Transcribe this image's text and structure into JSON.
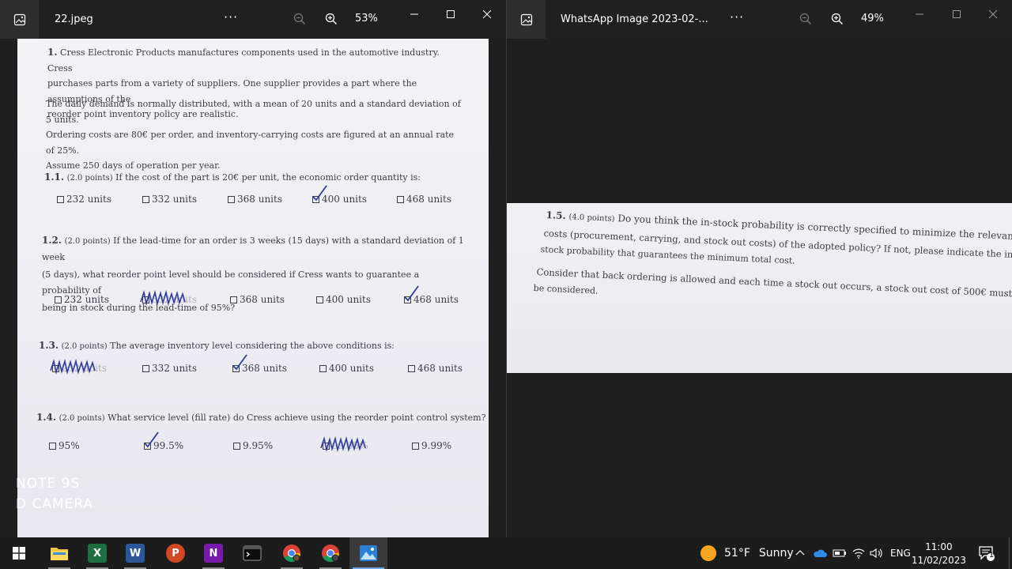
{
  "left_window": {
    "title": "22.jpeg",
    "more": "···",
    "zoom": "53%",
    "icons": [
      "photos-app-icon",
      "zoom-out-icon",
      "zoom-in-icon",
      "minimize-icon",
      "maximize-icon",
      "close-icon"
    ]
  },
  "right_window": {
    "title": "WhatsApp Image 2023-02-...",
    "more": "···",
    "zoom": "49%",
    "icons": [
      "photos-app-icon",
      "zoom-out-icon",
      "zoom-in-icon",
      "minimize-icon",
      "maximize-icon",
      "close-icon"
    ]
  },
  "document": {
    "intro_num": "1.",
    "intro_lines": [
      "Cress Electronic Products manufactures components used in the automotive industry. Cress",
      "purchases parts from a variety of suppliers. One supplier provides a part where the assumptions of the",
      "reorder point inventory policy are realistic."
    ],
    "details_lines": [
      "The daily demand is normally distributed, with a mean of 20 units and a standard deviation of 5 units.",
      "Ordering costs are 80€ per order, and inventory-carrying costs are figured at an annual rate of 25%.",
      "Assume 250 days of operation per year."
    ],
    "questions": [
      {
        "num": "1.1.",
        "points": "(2.0 points)",
        "text_lines": [
          "If the cost of the part is 20€ per unit, the economic order quantity is:"
        ],
        "options": [
          "232 units",
          "332 units",
          "368 units",
          "400 units",
          "468 units"
        ],
        "checked": 3,
        "scribbled": []
      },
      {
        "num": "1.2.",
        "points": "(2.0 points)",
        "text_lines": [
          "If the lead-time for an order is 3 weeks (15 days) with a standard deviation of 1 week",
          "(5 days), what reorder point level should be considered if Cress wants to guarantee a probability of",
          "being in stock during the lead-time of 95%?"
        ],
        "options": [
          "232 units",
          "332 units",
          "368 units",
          "400 units",
          "468 units"
        ],
        "checked": 4,
        "scribbled": [
          1
        ]
      },
      {
        "num": "1.3.",
        "points": "(2.0 points)",
        "text_lines": [
          "The average inventory level considering the above conditions is:"
        ],
        "options": [
          "232 units",
          "332 units",
          "368 units",
          "400 units",
          "468 units"
        ],
        "checked": 2,
        "scribbled": [
          0
        ]
      },
      {
        "num": "1.4.",
        "points": "(2.0 points)",
        "text_lines": [
          "What service level (fill rate) do Cress achieve using the reorder point control system?"
        ],
        "options": [
          "95%",
          "99.5%",
          "9.95%",
          "99.95%",
          "9.99%"
        ],
        "checked": 1,
        "scribbled": [
          3
        ]
      }
    ],
    "camera_watermark": [
      "NOTE 9S",
      "D CAMERA"
    ]
  },
  "right_document": {
    "num": "1.5.",
    "points": "(4.0 points)",
    "lines": [
      "Do you think the in-stock probability is correctly specified to minimize the relevant",
      "costs (procurement, carrying, and stock out costs) of the adopted policy? If not, please indicate the in-",
      "stock probability that guarantees the minimum total cost.",
      "Consider that back ordering is allowed and each time a stock out occurs, a stock out cost of 500€ must",
      "be considered."
    ]
  },
  "taskbar": {
    "apps": [
      {
        "name": "file-explorer",
        "letter": ""
      },
      {
        "name": "excel",
        "letter": "X",
        "color": "#1d6f42"
      },
      {
        "name": "word",
        "letter": "W",
        "color": "#2b579a"
      },
      {
        "name": "powerpoint",
        "letter": "P",
        "color": "#d24726"
      },
      {
        "name": "onenote",
        "letter": "N",
        "color": "#7719aa"
      },
      {
        "name": "terminal",
        "letter": ""
      },
      {
        "name": "chrome-profile-1",
        "letter": ""
      },
      {
        "name": "chrome-profile-2",
        "letter": ""
      },
      {
        "name": "photos",
        "letter": ""
      }
    ],
    "weather_temp": "51°F",
    "weather_desc": "Sunny",
    "language": "ENG",
    "time": "11:00",
    "date": "11/02/2023",
    "notification_count": "1",
    "colors": {
      "accent": "#79a8e6",
      "ink": "#2e3b9e"
    }
  }
}
